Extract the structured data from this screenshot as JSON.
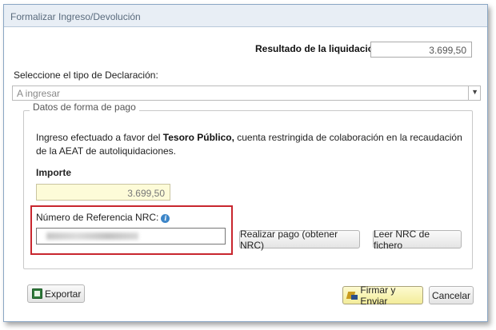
{
  "dialog": {
    "title": "Formalizar Ingreso/Devolución"
  },
  "resultado": {
    "label": "Resultado de la liquidación",
    "value": "3.699,50"
  },
  "declaracion": {
    "label": "Seleccione el tipo de Declaración:",
    "selected": "A ingresar"
  },
  "pago": {
    "legend": "Datos de forma de pago",
    "info_prefix": "Ingreso efectuado a favor del",
    "info_bold": "Tesoro Público,",
    "info_suffix": "cuenta restringida de colaboración en la recaudación de la AEAT de autoliquidaciones.",
    "importe_label": "Importe",
    "importe_value": "3.699,50",
    "nrc_label": "Número de Referencia  NRC:",
    "nrc_value_redacted": true,
    "realizar_pago_label": "Realizar pago (obtener NRC)",
    "leer_nrc_label": "Leer NRC de fichero"
  },
  "footer": {
    "exportar_label": "Exportar",
    "firmar_label": "Firmar y Enviar",
    "cancelar_label": "Cancelar"
  },
  "icons": {
    "info": "info-icon",
    "export": "export-icon",
    "sign": "sign-icon",
    "dropdown": "chevron-down-icon"
  },
  "colors": {
    "highlight_border": "#c8262e",
    "importe_bg": "#fdfbd8",
    "firmar_bg": "#f3ec9a",
    "titlebar_bg": "#e8eef5"
  }
}
